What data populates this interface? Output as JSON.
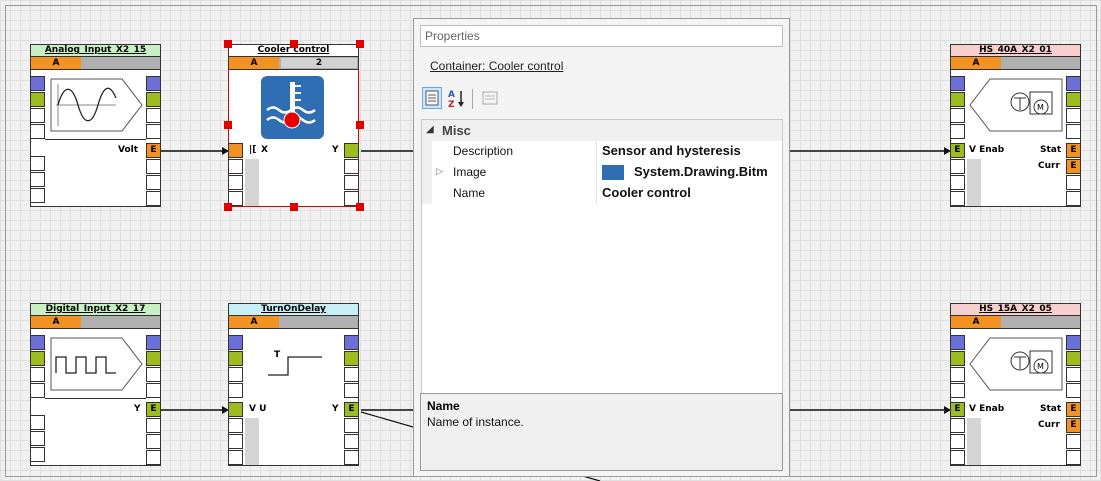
{
  "blocks": {
    "analog_input": {
      "title": "Analog_Input_X2_15",
      "header_a": "A",
      "out_label": "Volt",
      "out_pin": "E"
    },
    "cooler_control": {
      "title": "Cooler control",
      "header_a": "A",
      "header_2": "2",
      "in_label": "X",
      "out_label": "Y"
    },
    "hs_40a": {
      "title": "HS_40A_X2_01",
      "header_a": "A",
      "in_pin": "E",
      "in_label": "V Enab",
      "out1_label": "Stat",
      "out1_pin": "E",
      "out2_label": "Curr",
      "out2_pin": "E"
    },
    "digital_input": {
      "title": "Digital_Input_X2_17",
      "header_a": "A",
      "out_label": "Y",
      "out_pin": "E"
    },
    "turn_on_delay": {
      "title": "TurnOnDelay",
      "header_a": "A",
      "in_label": "V U",
      "out_label": "Y",
      "out_pin": "E",
      "icon_text": "T"
    },
    "hs_15a": {
      "title": "HS_15A_X2_05",
      "header_a": "A",
      "in_pin": "E",
      "in_label": "V Enab",
      "out1_label": "Stat",
      "out1_pin": "E",
      "out2_label": "Curr",
      "out2_pin": "E"
    }
  },
  "properties": {
    "title": "Properties",
    "container_label": "Container: Cooler control",
    "category": "Misc",
    "rows": [
      {
        "key": "Description",
        "value": "Sensor and hysteresis"
      },
      {
        "key": "Image",
        "value": "System.Drawing.Bitm"
      },
      {
        "key": "Name",
        "value": "Cooler control"
      }
    ],
    "desc_title": "Name",
    "desc_text": "Name of instance.",
    "toolbar": {
      "categorized": "categorized-icon",
      "alphabetical_sort": "sort-alphabetical-icon",
      "property_pages": "property-pages-icon"
    }
  },
  "colors": {
    "orange": "#f29222",
    "green": "#9cbc1f",
    "blue": "#6b6fd6",
    "selection": "#e00000",
    "title_green": "#c9f0c4",
    "title_red": "#f8cfcf",
    "title_cyan": "#c8eef6"
  }
}
